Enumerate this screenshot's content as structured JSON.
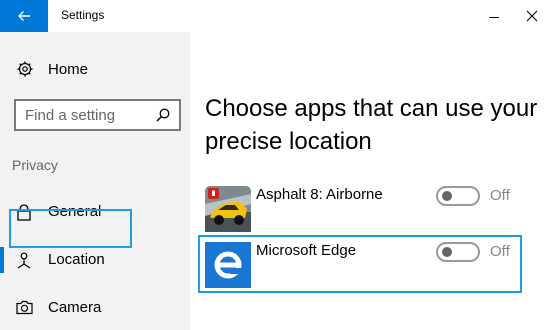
{
  "window": {
    "title": "Settings"
  },
  "sidebar": {
    "home_label": "Home",
    "search": {
      "placeholder": "Find a setting"
    },
    "section_label": "Privacy",
    "items": [
      {
        "label": "General",
        "icon": "lock-icon",
        "selected": false
      },
      {
        "label": "Location",
        "icon": "location-person-icon",
        "selected": true
      },
      {
        "label": "Camera",
        "icon": "camera-icon",
        "selected": false
      }
    ]
  },
  "main": {
    "heading": "Choose apps that can use your precise location",
    "apps": [
      {
        "name": "Asphalt 8: Airborne",
        "icon": "asphalt-app-icon",
        "toggle_on": false,
        "toggle_label": "Off"
      },
      {
        "name": "Microsoft Edge",
        "icon": "edge-app-icon",
        "toggle_on": false,
        "toggle_label": "Off"
      }
    ]
  },
  "colors": {
    "accent": "#0078d7",
    "highlight": "#1ba1e2",
    "sidebar_bg": "#f2f2f2"
  }
}
